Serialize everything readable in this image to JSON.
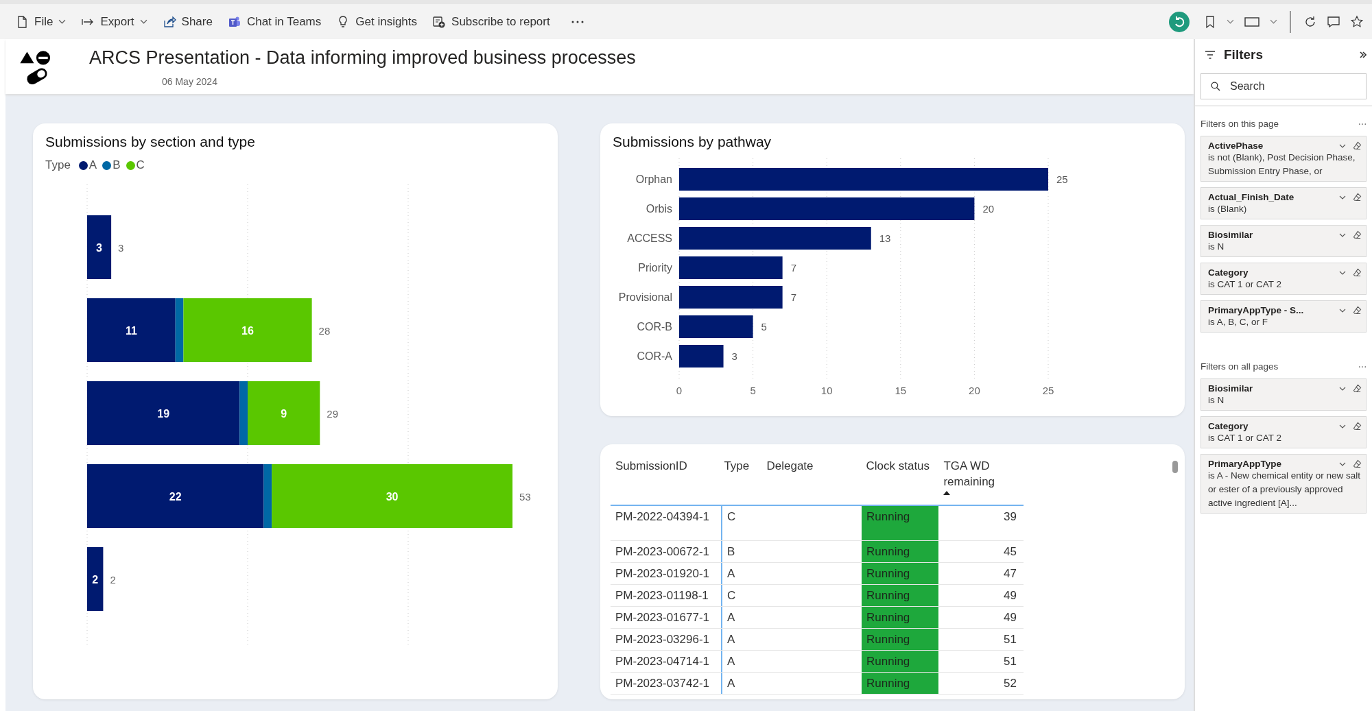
{
  "toolbar": {
    "items": [
      {
        "label": "File",
        "dropdown": true
      },
      {
        "label": "Export",
        "dropdown": true
      },
      {
        "label": "Share",
        "dropdown": false
      },
      {
        "label": "Chat in Teams",
        "dropdown": false
      },
      {
        "label": "Get insights",
        "dropdown": false
      },
      {
        "label": "Subscribe to report",
        "dropdown": false
      }
    ]
  },
  "header": {
    "title": "ARCS Presentation - Data informing improved business processes",
    "date": "06 May 2024"
  },
  "section_chart": {
    "title": "Submissions by section and type",
    "legend_title": "Type",
    "chart_data": {
      "type": "bar",
      "orientation": "horizontal",
      "stacked": true,
      "grid": true,
      "ref_lines": [
        {
          "axis": "x",
          "value": 0
        },
        {
          "axis": "x",
          "value": 20
        },
        {
          "axis": "x",
          "value": 40
        }
      ],
      "series": [
        {
          "name": "A",
          "color": "#001a70",
          "values": [
            3,
            11,
            19,
            22,
            2
          ],
          "value_labels": [
            "3",
            "11",
            "19",
            "22",
            "2"
          ]
        },
        {
          "name": "B",
          "color": "#0068a5",
          "values": [
            null,
            1,
            1,
            1,
            null
          ],
          "value_labels": [
            null,
            null,
            null,
            null,
            null
          ]
        },
        {
          "name": "C",
          "color": "#5ac700",
          "values": [
            null,
            16,
            9,
            30,
            null
          ],
          "value_labels": [
            null,
            "16",
            "9",
            "30",
            null
          ]
        }
      ],
      "totals": [
        "3",
        "28",
        "29",
        "53",
        "2"
      ]
    }
  },
  "pathway_chart": {
    "title": "Submissions by pathway",
    "chart_data": {
      "type": "bar",
      "orientation": "horizontal",
      "grid": true,
      "categories": [
        "Orphan",
        "Orbis",
        "ACCESS",
        "Priority",
        "Provisional",
        "COR-B",
        "COR-A"
      ],
      "values": [
        25,
        20,
        13,
        7,
        7,
        5,
        3
      ],
      "xticks": [
        0,
        5,
        10,
        15,
        20,
        25
      ],
      "xlim": [
        0,
        25
      ],
      "data_labels": true
    }
  },
  "table": {
    "columns": [
      {
        "label": "SubmissionID",
        "sorted": false
      },
      {
        "label": "Type",
        "sorted": false
      },
      {
        "label": "Delegate",
        "sorted": false
      },
      {
        "label": "Clock status",
        "sorted": false
      },
      {
        "label": "TGA WD remaining",
        "sorted": true
      }
    ],
    "rows": [
      {
        "id": "PM-2022-04394-1",
        "type": "C",
        "clock_status": "Running",
        "remaining": "39"
      },
      {
        "id": "PM-2023-00672-1",
        "type": "B",
        "clock_status": "Running",
        "remaining": "45"
      },
      {
        "id": "PM-2023-01920-1",
        "type": "A",
        "clock_status": "Running",
        "remaining": "47"
      },
      {
        "id": "PM-2023-01198-1",
        "type": "C",
        "clock_status": "Running",
        "remaining": "49"
      },
      {
        "id": "PM-2023-01677-1",
        "type": "A",
        "clock_status": "Running",
        "remaining": "49"
      },
      {
        "id": "PM-2023-03296-1",
        "type": "A",
        "clock_status": "Running",
        "remaining": "51"
      },
      {
        "id": "PM-2023-04714-1",
        "type": "A",
        "clock_status": "Running",
        "remaining": "51"
      },
      {
        "id": "PM-2023-03742-1",
        "type": "A",
        "clock_status": "Running",
        "remaining": "52"
      }
    ]
  },
  "filters": {
    "title": "Filters",
    "search_placeholder": "Search",
    "sections": [
      {
        "heading": "Filters on this page",
        "filters": [
          {
            "name": "ActivePhase",
            "condition": "is not (Blank), Post Decision Phase, Submission Entry Phase, or"
          },
          {
            "name": "Actual_Finish_Date",
            "condition": "is (Blank)"
          },
          {
            "name": "Biosimilar",
            "condition": "is N"
          },
          {
            "name": "Category",
            "condition": "is CAT 1 or CAT 2"
          },
          {
            "name": "PrimaryAppType - S...",
            "condition": "is A, B, C, or F"
          }
        ]
      },
      {
        "heading": "Filters on all pages",
        "filters": [
          {
            "name": "Biosimilar",
            "condition": "is N"
          },
          {
            "name": "Category",
            "condition": "is CAT 1 or CAT 2"
          },
          {
            "name": "PrimaryAppType",
            "condition": "is A - New chemical entity or new salt or ester of a previously approved active ingredient [A]..."
          }
        ]
      }
    ]
  }
}
